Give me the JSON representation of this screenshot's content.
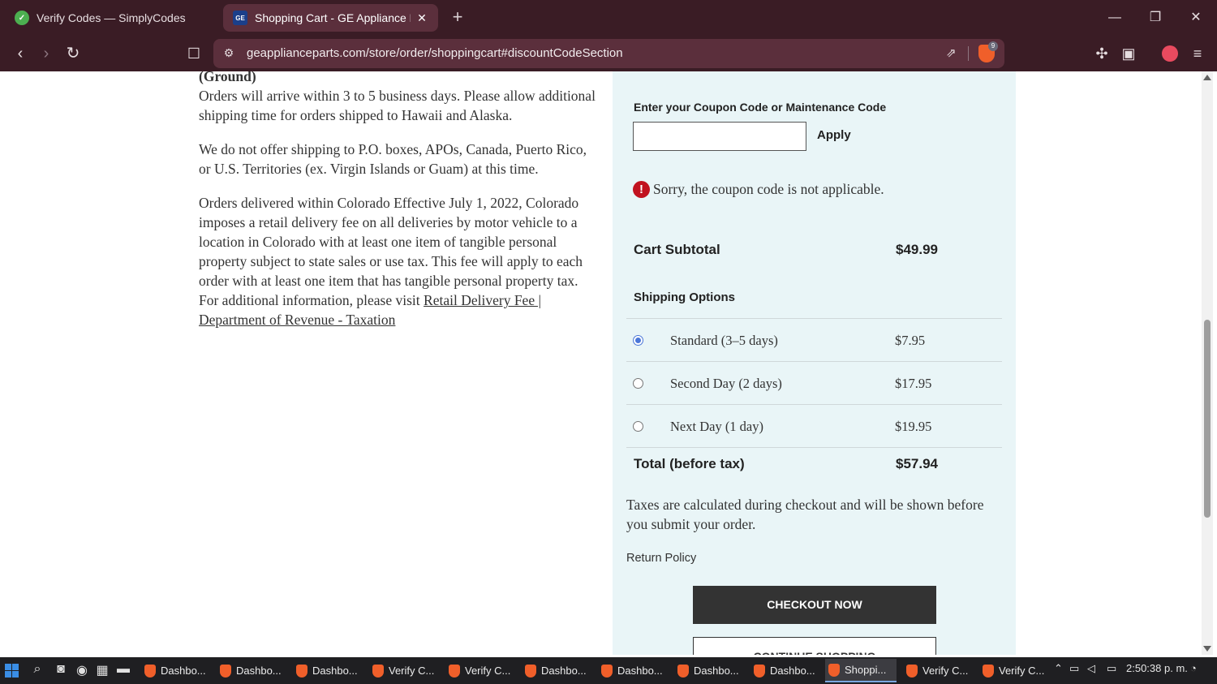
{
  "browser": {
    "tabs": [
      {
        "title": "Verify Codes — SimplyCodes",
        "icon": "simplycodes-icon",
        "active": false
      },
      {
        "title": "Shopping Cart - GE Appliance Pa",
        "icon": "ge-icon",
        "favicon_text": "GE",
        "active": true,
        "close": "✕"
      }
    ],
    "new_tab": "+",
    "window_controls": {
      "minimize": "—",
      "restore": "❐",
      "close": "✕"
    },
    "url": "geapplianceparts.com/store/order/shoppingcart#discountCodeSection",
    "brave_badge": "9"
  },
  "content": {
    "left": {
      "ground_heading": "(Ground)",
      "p1": "Orders will arrive within 3 to 5 business days. Please allow additional shipping time for orders shipped to Hawaii and Alaska.",
      "p2": "We do not offer shipping to P.O. boxes, APOs, Canada, Puerto Rico, or U.S. Territories (ex. Virgin Islands or Guam) at this time.",
      "p3": "Orders delivered within Colorado Effective July 1, 2022, Colorado imposes a retail delivery fee on all deliveries by motor vehicle to a location in Colorado with at least one item of tangible personal property subject to state sales or use tax. This fee will apply to each order with at least one item that has tangible personal property tax. For additional information, please visit ",
      "p3_link": "Retail Delivery Fee | Department of Revenue - Taxation"
    },
    "summary": {
      "coupon_label": "Enter your Coupon Code or Maintenance Code",
      "coupon_value": "",
      "apply_label": "Apply",
      "error_icon": "!",
      "error_message": "Sorry, the coupon code is not applicable.",
      "subtotal_label": "Cart Subtotal",
      "subtotal_value": "$49.99",
      "shipping_heading": "Shipping Options",
      "shipping_options": [
        {
          "label": "Standard (3–5 days)",
          "price": "$7.95",
          "selected": true
        },
        {
          "label": "Second Day (2 days)",
          "price": "$17.95",
          "selected": false
        },
        {
          "label": "Next Day (1 day)",
          "price": "$19.95",
          "selected": false
        }
      ],
      "total_label": "Total (before tax)",
      "total_value": "$57.94",
      "tax_note": "Taxes are calculated during checkout and will be shown before you submit your order.",
      "return_policy": "Return Policy",
      "checkout_label": "CHECKOUT NOW",
      "continue_label": "CONTINUE SHOPPING"
    }
  },
  "taskbar": {
    "items": [
      {
        "label": "Dashbo...",
        "active": false
      },
      {
        "label": "Dashbo...",
        "active": false
      },
      {
        "label": "Dashbo...",
        "active": false
      },
      {
        "label": "Verify C...",
        "active": false
      },
      {
        "label": "Verify C...",
        "active": false
      },
      {
        "label": "Dashbo...",
        "active": false
      },
      {
        "label": "Dashbo...",
        "active": false
      },
      {
        "label": "Dashbo...",
        "active": false
      },
      {
        "label": "Dashbo...",
        "active": false
      },
      {
        "label": "Shoppi...",
        "active": true
      },
      {
        "label": "Verify C...",
        "active": false
      },
      {
        "label": "Verify C...",
        "active": false
      }
    ],
    "clock": "2:50:38 p. m."
  }
}
